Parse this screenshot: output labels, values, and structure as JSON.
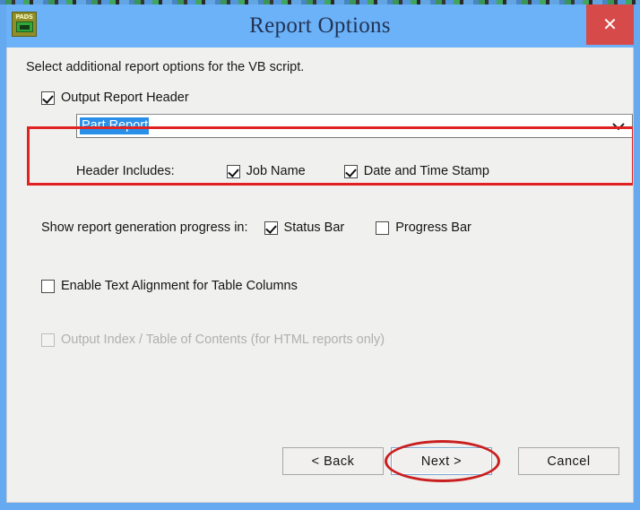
{
  "window": {
    "title": "Report Options",
    "app_icon": "pads-logo-icon",
    "icon_text": "PADS",
    "close_label": "✕",
    "titlebar_color": "#6cb2f8",
    "frame_color": "#65a9f0",
    "close_button_color": "#d64a4a"
  },
  "body": {
    "instruction": "Select additional report options for the VB script."
  },
  "output_header": {
    "label": "Output Report Header",
    "checked": true,
    "combo": {
      "value": "Part Report",
      "selected": true,
      "chevron": "⌄"
    }
  },
  "header_includes": {
    "label": "Header Includes:",
    "options": [
      {
        "label": "Job Name",
        "checked": true
      },
      {
        "label": "Date and Time Stamp",
        "checked": true
      }
    ]
  },
  "progress": {
    "label": "Show report generation progress in:",
    "options": [
      {
        "label": "Status Bar",
        "checked": true
      },
      {
        "label": "Progress Bar",
        "checked": false
      }
    ]
  },
  "text_alignment": {
    "label": "Enable Text Alignment for Table Columns",
    "checked": false,
    "disabled": false
  },
  "table_of_contents": {
    "label": "Output Index / Table of Contents (for HTML reports only)",
    "checked": false,
    "disabled": true
  },
  "buttons": {
    "back": "< Back",
    "next": "Next >",
    "cancel": "Cancel"
  },
  "annotations": {
    "header_box_color": "#e02222",
    "next_ellipse_color": "#c91f1f"
  }
}
